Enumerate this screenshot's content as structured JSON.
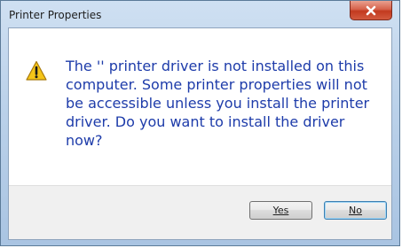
{
  "window": {
    "title": "Printer Properties",
    "close_icon": "close-icon"
  },
  "dialog": {
    "icon": "warning-icon",
    "message": "The '' printer driver is not installed on this computer. Some printer properties will not be accessible unless you install the printer driver. Do you want to install the driver now?"
  },
  "buttons": {
    "yes_label": "Yes",
    "no_label": "No"
  },
  "colors": {
    "message_text": "#1e3caa",
    "close_button": "#c23a1f",
    "warning_fill": "#f5c518"
  }
}
